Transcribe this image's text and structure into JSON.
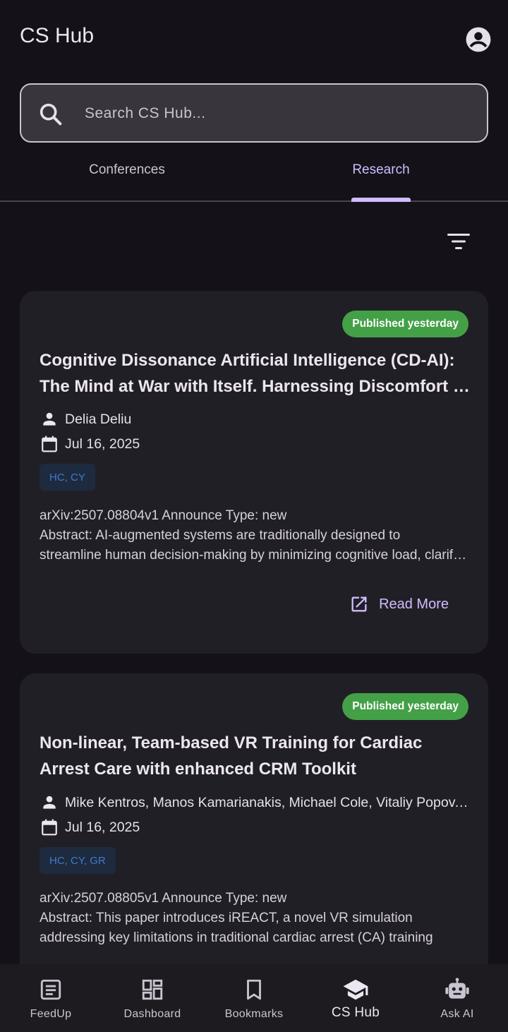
{
  "app": {
    "title": "CS Hub"
  },
  "search": {
    "placeholder": "Search CS Hub..."
  },
  "tabs": [
    {
      "label": "Conferences",
      "active": false
    },
    {
      "label": "Research",
      "active": true
    }
  ],
  "papers": [
    {
      "badge": "Published yesterday",
      "title": "Cognitive Dissonance Artificial Intelligence (CD-AI): The Mind at War with Itself. Harnessing Discomfort to Sharpen Critical Thinking",
      "authors": "Delia Deliu",
      "date": "Jul 16, 2025",
      "tags": "HC, CY",
      "announce": "arXiv:2507.08804v1 Announce Type: new",
      "abstract": "Abstract: AI-augmented systems are traditionally designed to",
      "abstract_2": "streamline human decision-making by minimizing cognitive load, clarifying arguments",
      "read_more": "Read More"
    },
    {
      "badge": "Published yesterday",
      "title": "Non-linear, Team-based VR Training for Cardiac Arrest Care with enhanced CRM Toolkit",
      "authors": "Mike Kentros, Manos Kamarianakis, Michael Cole, Vitaliy Popov, George Papagiannakis",
      "date": "Jul 16, 2025",
      "tags": "HC, CY, GR",
      "announce": "arXiv:2507.08805v1 Announce Type: new",
      "abstract": "Abstract: This paper introduces iREACT, a novel VR simulation",
      "abstract_2": "addressing key limitations in traditional cardiac arrest (CA) training"
    }
  ],
  "bottom_nav": [
    {
      "label": "FeedUp",
      "icon": "article-icon"
    },
    {
      "label": "Dashboard",
      "icon": "dashboard-icon"
    },
    {
      "label": "Bookmarks",
      "icon": "bookmark-icon"
    },
    {
      "label": "CS Hub",
      "icon": "school-icon",
      "active": true
    },
    {
      "label": "Ask AI",
      "icon": "robot-icon"
    }
  ],
  "colors": {
    "background": "#141218",
    "accent": "#D0BCFF",
    "badge": "#43A047",
    "card": "#211F26",
    "tag_text": "#3E7BD0"
  }
}
